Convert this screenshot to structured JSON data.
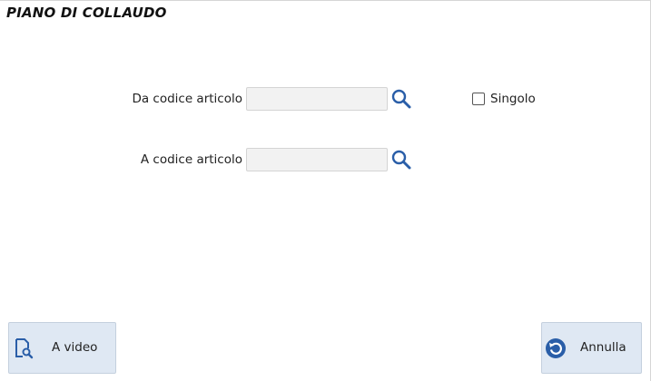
{
  "page": {
    "title": "PIANO DI COLLAUDO"
  },
  "form": {
    "from_code": {
      "label": "Da codice articolo",
      "value": ""
    },
    "to_code": {
      "label": "A codice articolo",
      "value": ""
    },
    "single": {
      "label": "Singolo",
      "checked": false
    }
  },
  "buttons": {
    "preview_label": "A video",
    "cancel_label": "Annulla"
  },
  "colors": {
    "accent": "#2a5ea8",
    "button_bg": "#dfe8f3",
    "field_bg": "#f2f2f2"
  },
  "icons": {
    "lookup": "magnifier-icon",
    "preview": "document-search-icon",
    "cancel": "undo-circle-icon"
  }
}
